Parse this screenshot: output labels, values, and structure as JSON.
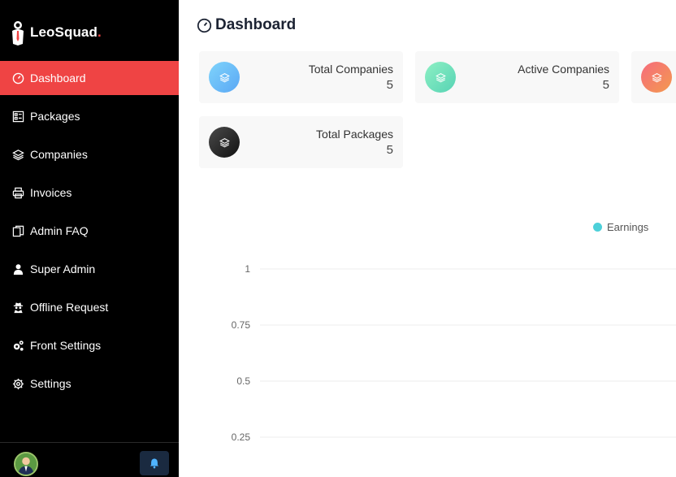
{
  "brand": {
    "name": "LeoSquad",
    "dot": "."
  },
  "sidebar": {
    "items": [
      {
        "label": "Dashboard",
        "icon": "dashboard-icon",
        "active": true
      },
      {
        "label": "Packages",
        "icon": "packages-icon"
      },
      {
        "label": "Companies",
        "icon": "layers-icon"
      },
      {
        "label": "Invoices",
        "icon": "printer-icon"
      },
      {
        "label": "Admin FAQ",
        "icon": "copy-icon"
      },
      {
        "label": "Super Admin",
        "icon": "user-icon"
      },
      {
        "label": "Offline Request",
        "icon": "spy-icon"
      },
      {
        "label": "Front Settings",
        "icon": "gears-icon"
      },
      {
        "label": "Settings",
        "icon": "gear-icon"
      }
    ],
    "footer": {
      "avatar": "avatar",
      "bell": "bell-icon"
    }
  },
  "header": {
    "title": "Dashboard"
  },
  "cards": [
    {
      "label": "Total Companies",
      "value": "5",
      "color_from": "#7fd4fb",
      "color_to": "#5aa7f5"
    },
    {
      "label": "Active Companies",
      "value": "5",
      "color_from": "#8ef0c4",
      "color_to": "#56d3b4"
    },
    {
      "label": "",
      "value": "",
      "color_from": "#f66b7d",
      "color_to": "#f39a4e"
    },
    {
      "label": "Total Packages",
      "value": "5",
      "color_from": "#4a4a4a",
      "color_to": "#111111"
    }
  ],
  "chart_data": {
    "type": "line",
    "series": [
      {
        "name": "Earnings",
        "values": []
      }
    ],
    "yticks": [
      "1",
      "0.75",
      "0.5",
      "0.25"
    ],
    "ylim": [
      0,
      1
    ],
    "grid": true,
    "legend_placement": "top-right",
    "series_color": "#4dd0d9"
  }
}
